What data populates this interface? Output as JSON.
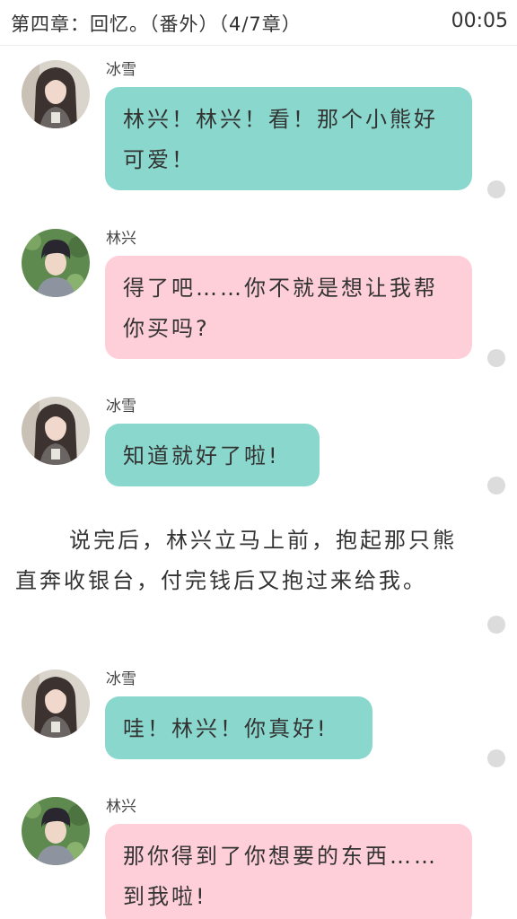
{
  "header": {
    "chapter_title": "第四章：回忆。（番外）（4/7章）",
    "time": "00:05"
  },
  "messages": [
    {
      "sender": "冰雪",
      "text": "林兴！林兴！看！那个小熊好可爱！",
      "bubble_color": "#8ad8cd",
      "avatar": "girl-avatar"
    },
    {
      "sender": "林兴",
      "text": "得了吧……你不就是想让我帮你买吗?",
      "bubble_color": "#ffcfd9",
      "avatar": "boy-avatar"
    },
    {
      "sender": "冰雪",
      "text": "知道就好了啦!",
      "bubble_color": "#8ad8cd",
      "avatar": "girl-avatar"
    },
    {
      "sender": "冰雪",
      "text": "哇！林兴！你真好!",
      "bubble_color": "#8ad8cd",
      "avatar": "girl-avatar"
    },
    {
      "sender": "林兴",
      "text": "那你得到了你想要的东西……到我啦!",
      "bubble_color": "#ffcfd9",
      "avatar": "boy-avatar"
    }
  ],
  "narration": {
    "text": "说完后，林兴立马上前，抱起那只熊直奔收银台，付完钱后又抱过来给我。"
  },
  "colors": {
    "teal_bubble": "#8ad8cd",
    "pink_bubble": "#ffcfd9",
    "read_dot": "#dcdcdc"
  }
}
